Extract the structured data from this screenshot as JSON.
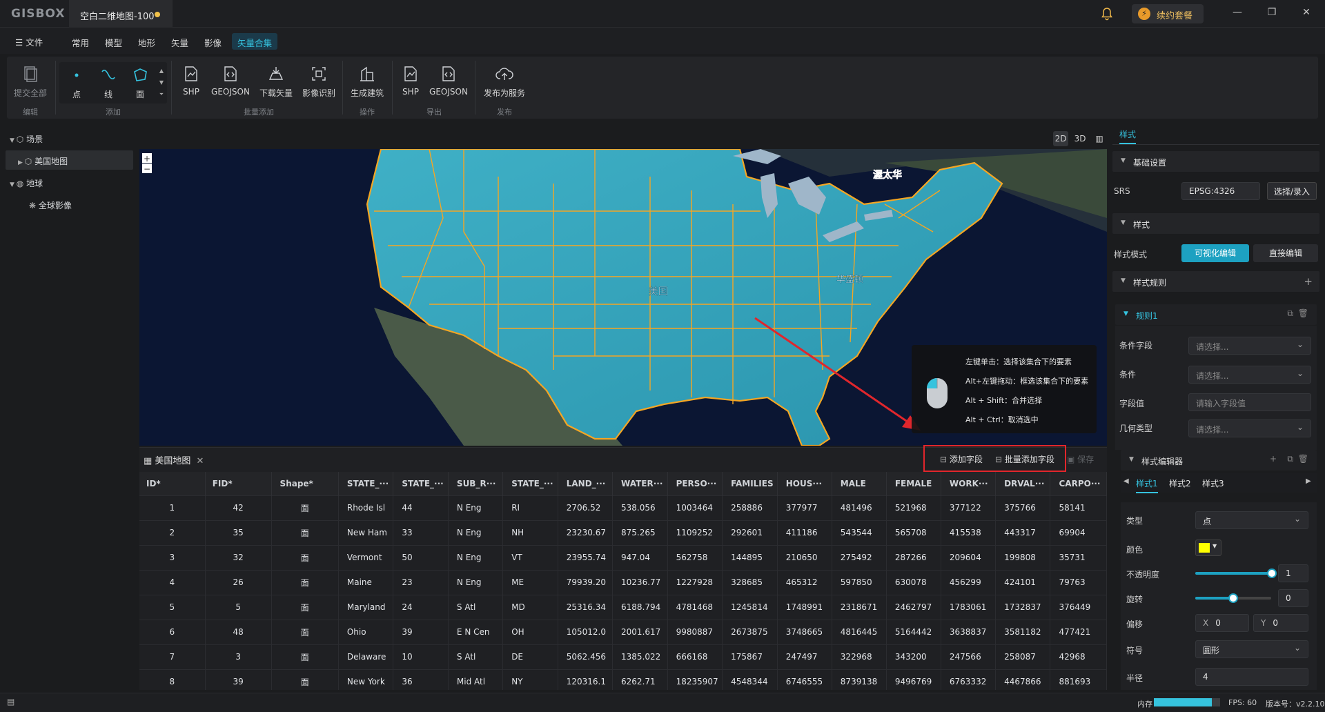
{
  "app": {
    "logo": "GISBOX",
    "doc_title": "空白二维地图-100",
    "renew_label": "续约套餐"
  },
  "menu": [
    "文件",
    "常用",
    "模型",
    "地形",
    "矢量",
    "影像",
    "矢量合集"
  ],
  "ribbon": {
    "buttons": {
      "submit_all": "提交全部",
      "point": "点",
      "line": "线",
      "polygon": "面",
      "shp1": "SHP",
      "geojson1": "GEOJSON",
      "download_vector": "下载矢量",
      "image_recognize": "影像识别",
      "gen_building": "生成建筑",
      "shp2": "SHP",
      "geojson2": "GEOJSON",
      "publish_service": "发布为服务"
    },
    "groups": {
      "edit": "编辑",
      "add": "添加",
      "batch_add": "批量添加",
      "operate": "操作",
      "export": "导出",
      "publish": "发布"
    }
  },
  "tree": {
    "scene": "场景",
    "us_map": "美国地图",
    "globe": "地球",
    "global_image": "全球影像"
  },
  "view_modes": [
    "2D",
    "3D",
    "▥"
  ],
  "map": {
    "zoom_in": "+",
    "zoom_out": "−",
    "label_us": "美国",
    "label_ottawa": "渥太华",
    "label_dc": "华盛顿"
  },
  "hint": {
    "l1": "左键单击：选择该集合下的要素",
    "l2": "Alt+左键拖动：框选该集合下的要素",
    "l3": "Alt + Shift：合并选择",
    "l4": "Alt + Ctrl：取消选中"
  },
  "table": {
    "tab_title": "美国地图",
    "add_field": "添加字段",
    "batch_add_field": "批量添加字段",
    "save": "保存",
    "columns": [
      "ID*",
      "FID*",
      "Shape*",
      "STATE_···",
      "STATE_···",
      "SUB_R···",
      "STATE_···",
      "LAND_···",
      "WATER···",
      "PERSO···",
      "FAMILIES",
      "HOUS···",
      "MALE",
      "FEMALE",
      "WORK···",
      "DRVAL···",
      "CARPO···"
    ],
    "rows": [
      [
        "1",
        "42",
        "面",
        "Rhode Isl",
        "44",
        "N Eng",
        "RI",
        "2706.52",
        "538.056",
        "1003464",
        "258886",
        "377977",
        "481496",
        "521968",
        "377122",
        "375766",
        "58141"
      ],
      [
        "2",
        "35",
        "面",
        "New Ham",
        "33",
        "N Eng",
        "NH",
        "23230.67",
        "875.265",
        "1109252",
        "292601",
        "411186",
        "543544",
        "565708",
        "415538",
        "443317",
        "69904"
      ],
      [
        "3",
        "32",
        "面",
        "Vermont",
        "50",
        "N Eng",
        "VT",
        "23955.74",
        "947.04",
        "562758",
        "144895",
        "210650",
        "275492",
        "287266",
        "209604",
        "199808",
        "35731"
      ],
      [
        "4",
        "26",
        "面",
        "Maine",
        "23",
        "N Eng",
        "ME",
        "79939.20",
        "10236.77",
        "1227928",
        "328685",
        "465312",
        "597850",
        "630078",
        "456299",
        "424101",
        "79763"
      ],
      [
        "5",
        "5",
        "面",
        "Maryland",
        "24",
        "S Atl",
        "MD",
        "25316.34",
        "6188.794",
        "4781468",
        "1245814",
        "1748991",
        "2318671",
        "2462797",
        "1783061",
        "1732837",
        "376449"
      ],
      [
        "6",
        "48",
        "面",
        "Ohio",
        "39",
        "E N Cen",
        "OH",
        "105012.0",
        "2001.617",
        "9980887",
        "2673875",
        "3748665",
        "4816445",
        "5164442",
        "3638837",
        "3581182",
        "477421"
      ],
      [
        "7",
        "3",
        "面",
        "Delaware",
        "10",
        "S Atl",
        "DE",
        "5062.456",
        "1385.022",
        "666168",
        "175867",
        "247497",
        "322968",
        "343200",
        "247566",
        "258087",
        "42968"
      ],
      [
        "8",
        "39",
        "面",
        "New York",
        "36",
        "Mid Atl",
        "NY",
        "120316.1",
        "6262.71",
        "18235907",
        "4548344",
        "6746555",
        "8739138",
        "9496769",
        "6763332",
        "4467866",
        "881693"
      ]
    ]
  },
  "right": {
    "tab": "样式",
    "basic": "基础设置",
    "srs_label": "SRS",
    "srs_value": "EPSG:4326",
    "srs_btn": "选择/录入",
    "style": "样式",
    "style_mode": "样式模式",
    "visual_edit": "可视化编辑",
    "direct_edit": "直接编辑",
    "style_rules": "样式规则",
    "rule1": "规则1",
    "cond_field": "条件字段",
    "cond_field_ph": "请选择...",
    "cond": "条件",
    "cond_ph": "请选择...",
    "field_val": "字段值",
    "field_val_ph": "请输入字段值",
    "geom_type": "几何类型",
    "geom_type_ph": "请选择...",
    "style_editor": "样式编辑器",
    "style_tabs": [
      "样式1",
      "样式2",
      "样式3"
    ],
    "type_label": "类型",
    "type_value": "点",
    "color_label": "颜色",
    "color_value": "#ffff00",
    "opacity_label": "不透明度",
    "opacity_value": "1",
    "rotation_label": "旋转",
    "rotation_value": "0",
    "offset_label": "偏移",
    "offset_x_label": "X",
    "offset_x": "0",
    "offset_y_label": "Y",
    "offset_y": "0",
    "symbol_label": "符号",
    "symbol_value": "圆形",
    "radius_label": "半径",
    "radius_value": "4"
  },
  "status": {
    "memory": "内存",
    "fps": "FPS: 60",
    "version": "版本号：v2.2.10"
  }
}
